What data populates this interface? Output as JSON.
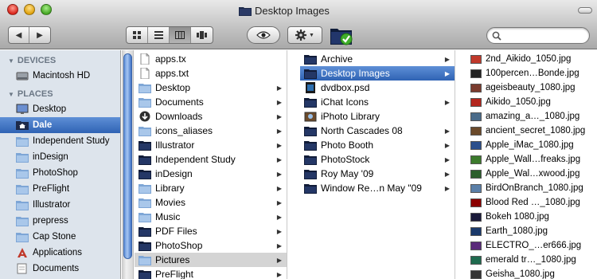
{
  "window": {
    "title": "Desktop Images"
  },
  "toolbar": {
    "back_label": "◀",
    "forward_label": "▶",
    "search_placeholder": ""
  },
  "sidebar": {
    "devices_header": "DEVICES",
    "places_header": "PLACES",
    "devices": [
      {
        "label": "Macintosh HD",
        "icon": "hard-drive-icon"
      }
    ],
    "places": [
      {
        "label": "Desktop",
        "icon": "desktop-icon"
      },
      {
        "label": "Dale",
        "icon": "home-icon"
      },
      {
        "label": "Independent Study",
        "icon": "folder-icon"
      },
      {
        "label": "inDesign",
        "icon": "folder-icon"
      },
      {
        "label": "PhotoShop",
        "icon": "folder-icon"
      },
      {
        "label": "PreFlight",
        "icon": "folder-icon"
      },
      {
        "label": "Illustrator",
        "icon": "folder-icon"
      },
      {
        "label": "prepress",
        "icon": "folder-icon"
      },
      {
        "label": "Cap Stone",
        "icon": "folder-icon"
      },
      {
        "label": "Applications",
        "icon": "applications-icon"
      },
      {
        "label": "Documents",
        "icon": "documents-icon"
      }
    ]
  },
  "column1": [
    {
      "label": "apps.tx",
      "icon": "document-icon"
    },
    {
      "label": "apps.txt",
      "icon": "document-icon"
    },
    {
      "label": "Desktop",
      "icon": "folder-icon"
    },
    {
      "label": "Documents",
      "icon": "folder-icon"
    },
    {
      "label": "Downloads",
      "icon": "downloads-icon"
    },
    {
      "label": "icons_aliases",
      "icon": "folder-icon"
    },
    {
      "label": "Illustrator",
      "icon": "dark-folder-icon"
    },
    {
      "label": "Independent Study",
      "icon": "dark-folder-icon"
    },
    {
      "label": "inDesign",
      "icon": "dark-folder-icon"
    },
    {
      "label": "Library",
      "icon": "folder-icon"
    },
    {
      "label": "Movies",
      "icon": "folder-icon"
    },
    {
      "label": "Music",
      "icon": "folder-icon"
    },
    {
      "label": "PDF Files",
      "icon": "dark-folder-icon"
    },
    {
      "label": "PhotoShop",
      "icon": "dark-folder-icon"
    },
    {
      "label": "Pictures",
      "icon": "folder-icon"
    },
    {
      "label": "PreFlight",
      "icon": "dark-folder-icon"
    }
  ],
  "column2": [
    {
      "label": "Archive",
      "icon": "dark-folder-icon"
    },
    {
      "label": "Desktop Images",
      "icon": "dark-folder-icon"
    },
    {
      "label": "dvdbox.psd",
      "icon": "psd-file-icon"
    },
    {
      "label": "iChat Icons",
      "icon": "dark-folder-icon"
    },
    {
      "label": "iPhoto Library",
      "icon": "iphoto-icon"
    },
    {
      "label": "North Cascades 08",
      "icon": "dark-folder-icon"
    },
    {
      "label": "Photo Booth",
      "icon": "dark-folder-icon"
    },
    {
      "label": "PhotoStock",
      "icon": "dark-folder-icon"
    },
    {
      "label": "Roy May '09",
      "icon": "dark-folder-icon"
    },
    {
      "label": "Window Re…n May \"09",
      "icon": "dark-folder-icon"
    }
  ],
  "column3": [
    {
      "label": "2nd_Aikido_1050.jpg",
      "color": "#c0392b"
    },
    {
      "label": "100percen…Bonde.jpg",
      "color": "#222222"
    },
    {
      "label": "ageisbeauty_1080.jpg",
      "color": "#7a3b2e"
    },
    {
      "label": "Aikido_1050.jpg",
      "color": "#b3261e"
    },
    {
      "label": "amazing_a…_1080.jpg",
      "color": "#4a6b8a"
    },
    {
      "label": "ancient_secret_1080.jpg",
      "color": "#6b4a2a"
    },
    {
      "label": "Apple_iMac_1080.jpg",
      "color": "#2b4f8c"
    },
    {
      "label": "Apple_Wall…freaks.jpg",
      "color": "#3c7a2c"
    },
    {
      "label": "Apple_Wal…xwood.jpg",
      "color": "#2c5f2c"
    },
    {
      "label": "BirdOnBranch_1080.jpg",
      "color": "#5a7fa8"
    },
    {
      "label": "Blood Red …_1080.jpg",
      "color": "#8b0000"
    },
    {
      "label": "Bokeh 1080.jpg",
      "color": "#1a1a3a"
    },
    {
      "label": "Earth_1080.jpg",
      "color": "#1b3a6b"
    },
    {
      "label": "ELECTRO_…er666.jpg",
      "color": "#5a2a7a"
    },
    {
      "label": "emerald tr…_1080.jpg",
      "color": "#1f6b4f"
    },
    {
      "label": "Geisha_1080.jpg",
      "color": "#333333"
    }
  ]
}
